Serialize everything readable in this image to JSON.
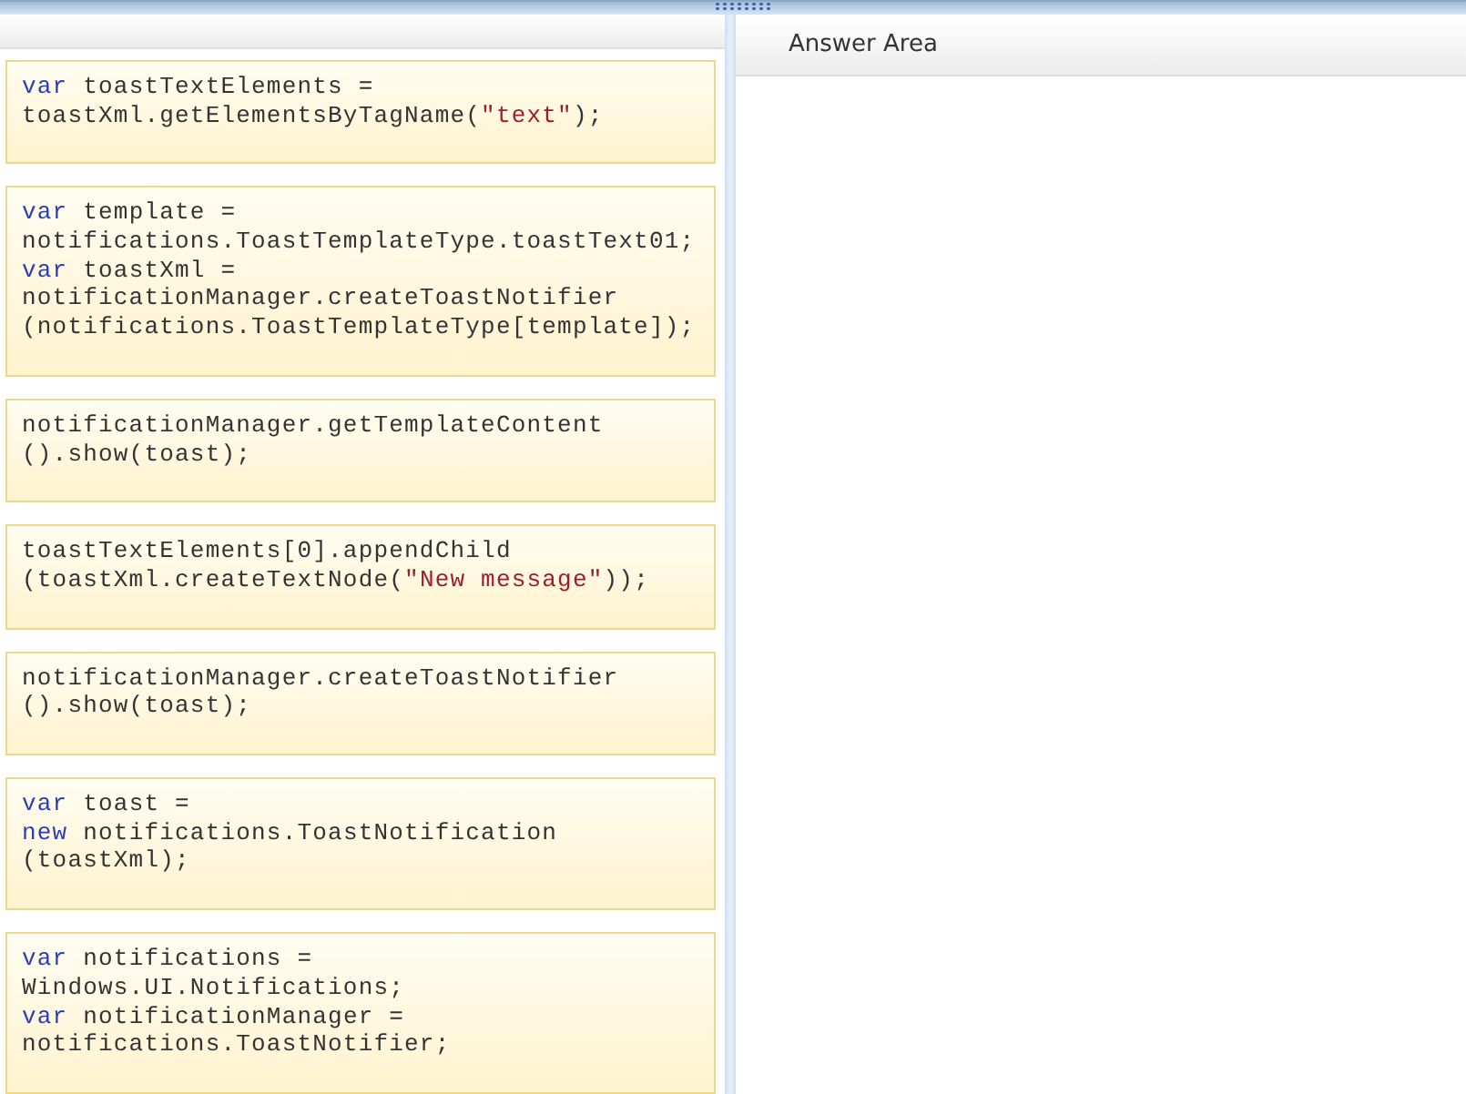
{
  "answer_area": {
    "title": "Answer Area"
  },
  "code_tiles": [
    {
      "lines": [
        [
          {
            "kind": "keyword",
            "text": "var"
          },
          {
            "kind": "plain",
            "text": " toastTextElements ="
          }
        ],
        [
          {
            "kind": "plain",
            "text": "toastXml.getElementsByTagName("
          },
          {
            "kind": "string",
            "text": "\"text\""
          },
          {
            "kind": "plain",
            "text": ");"
          }
        ]
      ]
    },
    {
      "lines": [
        [
          {
            "kind": "keyword",
            "text": "var"
          },
          {
            "kind": "plain",
            "text": " template ="
          }
        ],
        [
          {
            "kind": "plain",
            "text": "notifications.ToastTemplateType.toastText01;"
          }
        ],
        [
          {
            "kind": "keyword",
            "text": "var"
          },
          {
            "kind": "plain",
            "text": " toastXml ="
          }
        ],
        [
          {
            "kind": "plain",
            "text": "notificationManager.createToastNotifier"
          }
        ],
        [
          {
            "kind": "plain",
            "text": "(notifications.ToastTemplateType[template]);"
          }
        ]
      ]
    },
    {
      "lines": [
        [
          {
            "kind": "plain",
            "text": "notificationManager.getTemplateContent"
          }
        ],
        [
          {
            "kind": "plain",
            "text": "().show(toast);"
          }
        ]
      ]
    },
    {
      "lines": [
        [
          {
            "kind": "plain",
            "text": "toastTextElements[0].appendChild"
          }
        ],
        [
          {
            "kind": "plain",
            "text": "(toastXml.createTextNode("
          },
          {
            "kind": "string",
            "text": "\"New message\""
          },
          {
            "kind": "plain",
            "text": "));"
          }
        ]
      ]
    },
    {
      "lines": [
        [
          {
            "kind": "plain",
            "text": "notificationManager.createToastNotifier"
          }
        ],
        [
          {
            "kind": "plain",
            "text": "().show(toast);"
          }
        ]
      ]
    },
    {
      "lines": [
        [
          {
            "kind": "keyword",
            "text": "var"
          },
          {
            "kind": "plain",
            "text": " toast ="
          }
        ],
        [
          {
            "kind": "keyword",
            "text": "new"
          },
          {
            "kind": "plain",
            "text": " notifications.ToastNotification"
          }
        ],
        [
          {
            "kind": "plain",
            "text": "(toastXml);"
          }
        ]
      ]
    },
    {
      "lines": [
        [
          {
            "kind": "keyword",
            "text": "var"
          },
          {
            "kind": "plain",
            "text": " notifications ="
          }
        ],
        [
          {
            "kind": "plain",
            "text": "Windows.UI.Notifications;"
          }
        ],
        [
          {
            "kind": "keyword",
            "text": "var"
          },
          {
            "kind": "plain",
            "text": " notificationManager ="
          }
        ],
        [
          {
            "kind": "plain",
            "text": "notifications.ToastNotifier;"
          }
        ]
      ]
    }
  ]
}
